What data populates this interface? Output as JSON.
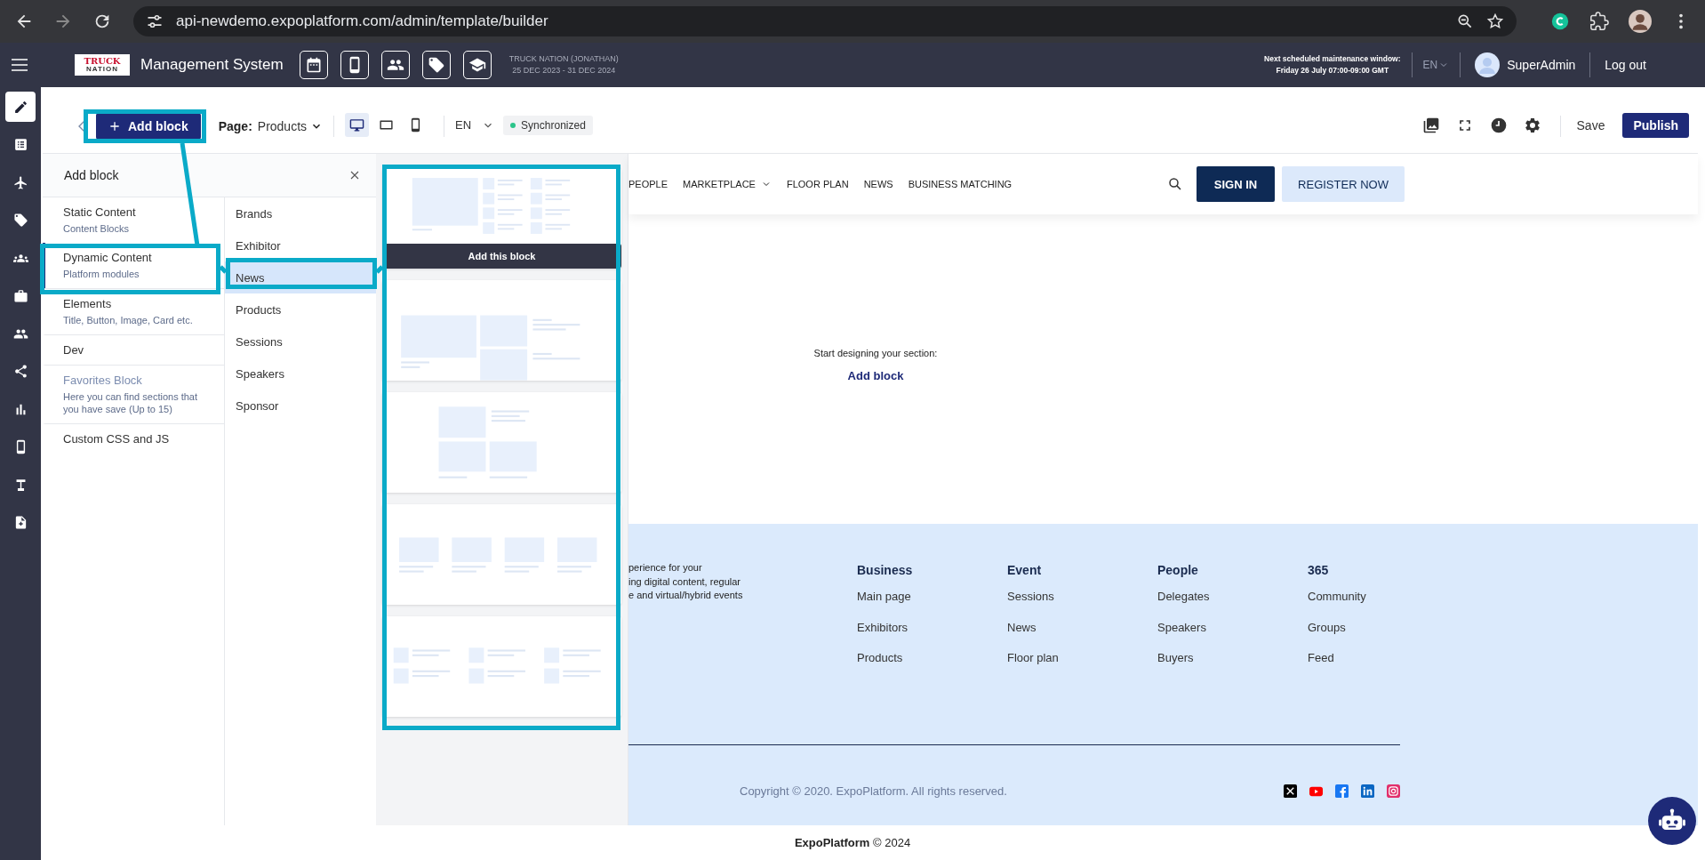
{
  "browser": {
    "url": "api-newdemo.expoplatform.com/admin/template/builder"
  },
  "header": {
    "logo": [
      "TRUCK",
      "NATION"
    ],
    "title": "Management System",
    "event_name": "TRUCK NATION (JONATHAN)",
    "event_dates": "25 DEC 2023 - 31 DEC 2024",
    "maintenance": [
      "Next scheduled maintenance window:",
      "Friday 26 July 07:00-09:00 GMT"
    ],
    "language": "EN",
    "user": "SuperAdmin",
    "logout": "Log out"
  },
  "sidebar": {
    "items": [
      {
        "selected": true
      },
      {
        "selected": false
      },
      {
        "selected": false
      },
      {
        "selected": false
      },
      {
        "selected": false
      },
      {
        "selected": false
      },
      {
        "selected": false
      },
      {
        "selected": false
      },
      {
        "selected": false
      },
      {
        "selected": false
      },
      {
        "selected": false
      },
      {
        "selected": false
      }
    ]
  },
  "toolbar": {
    "add_block": "Add block",
    "page_label": "Page:",
    "page_value": "Products",
    "devices": [
      {
        "selected": true
      },
      {
        "selected": false
      },
      {
        "selected": false
      }
    ],
    "language": "EN",
    "status": "Synchronized",
    "save": "Save",
    "publish": "Publish"
  },
  "panel": {
    "title": "Add block",
    "categories": [
      {
        "title": "Static Content",
        "subtitle": "Content Blocks",
        "selected": false,
        "disabled": false
      },
      {
        "title": "Dynamic Content",
        "subtitle": "Platform modules",
        "selected": true,
        "disabled": false
      },
      {
        "title": "Elements",
        "subtitle": "Title, Button, Image, Card etc.",
        "selected": false,
        "disabled": false
      },
      {
        "title": "Dev",
        "selected": false,
        "disabled": false
      },
      {
        "title": "Favorites Block",
        "subtitle": "Here you can find sections that you have save (Up to 15)",
        "selected": false,
        "disabled": true
      },
      {
        "title": "Custom CSS and JS",
        "selected": false,
        "disabled": false
      }
    ],
    "modules": [
      {
        "label": "Brands",
        "selected": false
      },
      {
        "label": "Exhibitor",
        "selected": false
      },
      {
        "label": "News",
        "selected": true
      },
      {
        "label": "Products",
        "selected": false
      },
      {
        "label": "Sessions",
        "selected": false
      },
      {
        "label": "Speakers",
        "selected": false
      },
      {
        "label": "Sponsor",
        "selected": false
      }
    ],
    "thumbnails": [
      {
        "kind": "feature-list",
        "action": "Add this block"
      },
      {
        "kind": "feature-grid"
      },
      {
        "kind": "center-grid"
      },
      {
        "kind": "four-columns"
      },
      {
        "kind": "three-columns"
      }
    ]
  },
  "site": {
    "nav": [
      {
        "label": "PEOPLE",
        "dropdown": false
      },
      {
        "label": "MARKETPLACE",
        "dropdown": true
      },
      {
        "label": "FLOOR PLAN",
        "dropdown": false
      },
      {
        "label": "NEWS",
        "dropdown": false
      },
      {
        "label": "BUSINESS MATCHING",
        "dropdown": false
      }
    ],
    "sign_in": "SIGN IN",
    "register": "REGISTER NOW",
    "empty_text": "Start designing your section:",
    "empty_link": "Add block",
    "footer": {
      "intro": [
        "perience for your",
        "ing digital content, regular",
        "e and virtual/hybrid events"
      ],
      "columns": [
        {
          "heading": "Business",
          "links": [
            "Main page",
            "Exhibitors",
            "Products"
          ]
        },
        {
          "heading": "Event",
          "links": [
            "Sessions",
            "News",
            "Floor plan"
          ]
        },
        {
          "heading": "People",
          "links": [
            "Delegates",
            "Speakers",
            "Buyers"
          ]
        },
        {
          "heading": "365",
          "links": [
            "Community",
            "Groups",
            "Feed"
          ]
        }
      ],
      "copyright": "Copyright © 2020. ExpoPlatform. All rights reserved."
    }
  },
  "bottom": "**ExpoPlatform** © 2024"
}
